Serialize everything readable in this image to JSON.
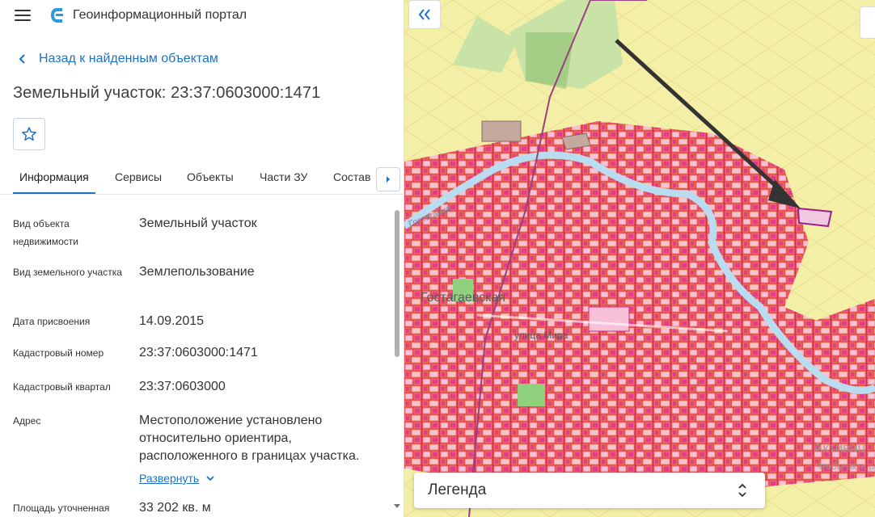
{
  "app": {
    "title": "Геоинформационный портал"
  },
  "nav": {
    "back_label": "Назад к найденным объектам"
  },
  "object": {
    "title": "Земельный участок: 23:37:0603000:1471"
  },
  "tabs": [
    {
      "label": "Информация",
      "active": true
    },
    {
      "label": "Сервисы",
      "active": false
    },
    {
      "label": "Объекты",
      "active": false
    },
    {
      "label": "Части ЗУ",
      "active": false
    },
    {
      "label": "Состав",
      "active": false
    }
  ],
  "info": {
    "rows": [
      {
        "key": "Вид объекта недвижимости",
        "value": "Земельный участок"
      },
      {
        "key": "Вид земельного участка",
        "value": "Землепользование"
      },
      {
        "key": "Дата присвоения",
        "value": "14.09.2015"
      },
      {
        "key": "Кадастровый номер",
        "value": "23:37:0603000:1471"
      },
      {
        "key": "Кадастровый квартал",
        "value": "23:37:0603000"
      },
      {
        "key": "Адрес",
        "value": "Местоположение установлено относительно ориентира, расположенного в границах участка."
      },
      {
        "key": "Площадь уточненная",
        "value": "33 202 кв. м"
      }
    ],
    "expand_label": "Развернуть"
  },
  "map": {
    "labels": {
      "settlement": "Гостагаевская",
      "street": "улица Мира",
      "river": "Гостагайка"
    },
    "legend_label": "Легенда",
    "watermark": "Активац",
    "watermark_sub": "Чтобы акти разд Пара"
  },
  "colors": {
    "accent": "#1a73c8",
    "parcel_fill": "#d8257a",
    "parcel_outline": "#f08a3a",
    "map_bg": "#f3efa6",
    "river": "#b9dcf0"
  }
}
